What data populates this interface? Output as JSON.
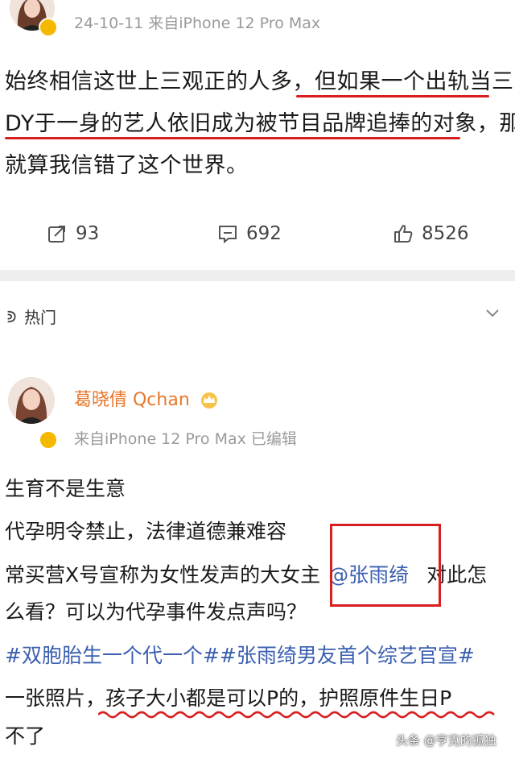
{
  "post1": {
    "meta": "24-10-11  来自iPhone 12 Pro Max",
    "lines": [
      "始终相信这世上三观正的人多，但如果一个出轨当三",
      "DY于一身的艺人依旧成为被节目品牌追捧的对象，那",
      "就算我信错了这个世界。"
    ],
    "actions": {
      "repost": "93",
      "comment": "692",
      "like": "8526"
    }
  },
  "section": {
    "label": "热门"
  },
  "post2": {
    "author": "葛晓倩 Qchan",
    "meta": "来自iPhone 12 Pro Max  已编辑",
    "line1": "生育不是生意",
    "line2": "代孕明令禁止，法律道德兼难容",
    "line3_before": "常买营X号宣称为女性发声的大女主",
    "line3_mention": "@张雨绮",
    "line3_after": "对此怎",
    "line4": "么看？可以为代孕事件发点声吗？",
    "line5": "#双胞胎生一个代一个##张雨绮男友首个综艺官宣#",
    "line6": "一张照片，孩子大小都是可以P的，护照原件生日P",
    "line7": "不了"
  },
  "watermark": "头条 @亨克的孤独",
  "colors": {
    "red": "#d81e1e",
    "link": "#3b5fb0",
    "name": "#e8772a",
    "badge": "#f5b800"
  }
}
